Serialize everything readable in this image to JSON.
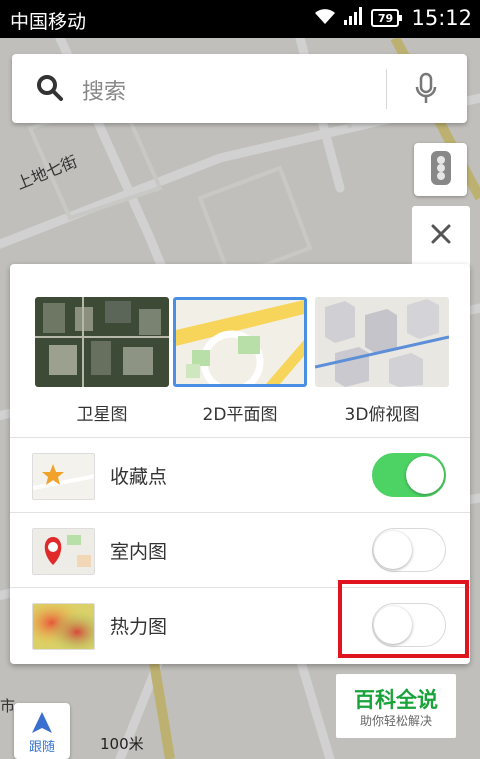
{
  "status_bar": {
    "carrier": "中国移动",
    "battery": "79",
    "time": "15:12"
  },
  "search": {
    "placeholder": "搜索"
  },
  "map": {
    "street_label": "上地七街",
    "left_label": "市",
    "scale_label": "100米",
    "follow_label": "跟随"
  },
  "layers_panel": {
    "map_types": [
      {
        "label": "卫星图",
        "selected": false
      },
      {
        "label": "2D平面图",
        "selected": true
      },
      {
        "label": "3D俯视图",
        "selected": false
      }
    ],
    "overlays": [
      {
        "label": "收藏点",
        "enabled": true
      },
      {
        "label": "室内图",
        "enabled": false
      },
      {
        "label": "热力图",
        "enabled": false
      }
    ]
  },
  "colors": {
    "toggle_on": "#4cd364",
    "selection_border": "#4a90e2",
    "highlight_box": "#e0141e",
    "watermark_green": "#1aa33a"
  },
  "watermark": {
    "title": "百科全说",
    "subtitle": "助你轻松解决"
  }
}
